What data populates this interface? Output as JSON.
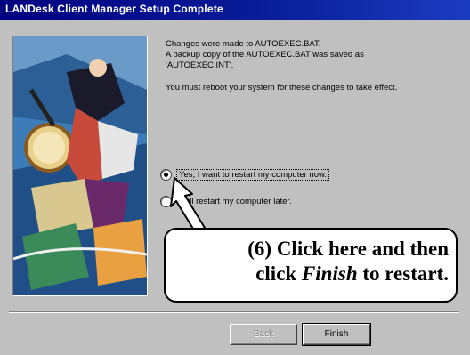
{
  "window": {
    "title": "LANDesk Client Manager Setup Complete"
  },
  "message": {
    "line1": "Changes were made to AUTOEXEC.BAT.",
    "line2": "A backup copy of the AUTOEXEC.BAT was saved as",
    "line3": "'AUTOEXEC.INT'.",
    "line4": "You must reboot your system for these changes to take effect."
  },
  "options": [
    {
      "label": "Yes, I want to restart my computer now.",
      "selected": true
    },
    {
      "label": "I will restart my computer later.",
      "selected": false
    }
  ],
  "callout": {
    "line1": "(6)  Click here and then",
    "line2_pre": "click ",
    "line2_em": "Finish",
    "line2_post": " to restart."
  },
  "buttons": {
    "back_label": "Back",
    "finish_label": "Finish"
  }
}
